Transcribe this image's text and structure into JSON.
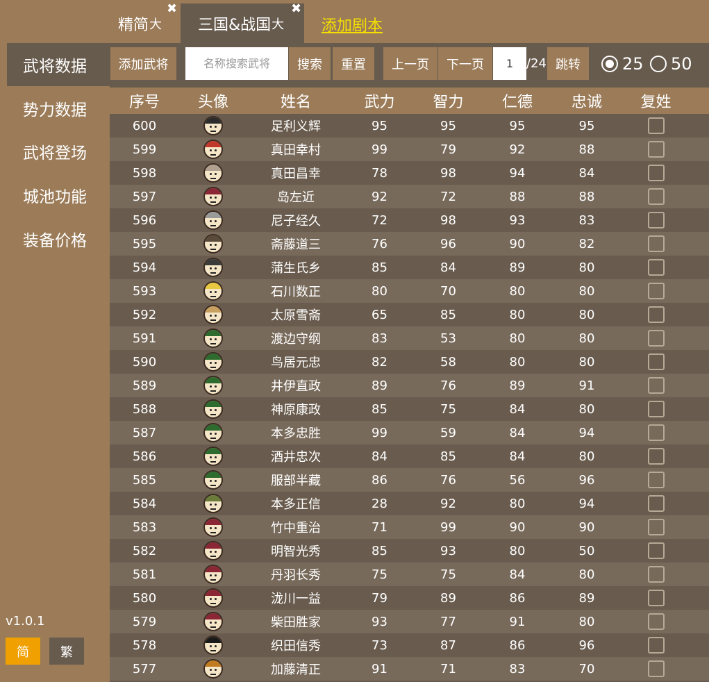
{
  "tabs": [
    {
      "label": "精简",
      "suffix": "大"
    },
    {
      "label": "三国&战国",
      "suffix": "大"
    }
  ],
  "tab_close_glyph": "✖",
  "add_script_label": "添加剧本",
  "toolbar": {
    "add_general": "添加武将",
    "search_placeholder": "名称搜索武将",
    "search": "搜索",
    "reset": "重置",
    "prev_page": "上一页",
    "next_page": "下一页",
    "page_value": "1",
    "page_total": "/24",
    "jump": "跳转",
    "page_size_options": [
      "25",
      "50"
    ],
    "page_size_selected": "25"
  },
  "sidebar": {
    "items": [
      {
        "label": "武将数据",
        "active": true
      },
      {
        "label": "势力数据",
        "active": false
      },
      {
        "label": "武将登场",
        "active": false
      },
      {
        "label": "城池功能",
        "active": false
      },
      {
        "label": "装备价格",
        "active": false
      }
    ],
    "version": "v1.0.1",
    "lang_simplified": "简",
    "lang_traditional": "繁"
  },
  "table": {
    "headers": [
      "序号",
      "头像",
      "姓名",
      "武力",
      "智力",
      "仁德",
      "忠诚",
      "复姓"
    ],
    "rows": [
      {
        "id": "600",
        "name": "足利义辉",
        "war": "95",
        "int": "95",
        "virtue": "95",
        "loyalty": "95",
        "avatar_color": "#2b2b2b"
      },
      {
        "id": "599",
        "name": "真田幸村",
        "war": "99",
        "int": "79",
        "virtue": "92",
        "loyalty": "88",
        "avatar_color": "#c0392b"
      },
      {
        "id": "598",
        "name": "真田昌幸",
        "war": "78",
        "int": "98",
        "virtue": "94",
        "loyalty": "84",
        "avatar_color": "#b0a090"
      },
      {
        "id": "597",
        "name": "岛左近",
        "war": "92",
        "int": "72",
        "virtue": "88",
        "loyalty": "88",
        "avatar_color": "#8b2635"
      },
      {
        "id": "596",
        "name": "尼子经久",
        "war": "72",
        "int": "98",
        "virtue": "93",
        "loyalty": "83",
        "avatar_color": "#9a9a9a"
      },
      {
        "id": "595",
        "name": "斋藤道三",
        "war": "76",
        "int": "96",
        "virtue": "90",
        "loyalty": "82",
        "avatar_color": "#5a4a3a"
      },
      {
        "id": "594",
        "name": "蒲生氏乡",
        "war": "85",
        "int": "84",
        "virtue": "89",
        "loyalty": "80",
        "avatar_color": "#3a3a3a"
      },
      {
        "id": "593",
        "name": "石川数正",
        "war": "80",
        "int": "70",
        "virtue": "80",
        "loyalty": "80",
        "avatar_color": "#e8c840"
      },
      {
        "id": "592",
        "name": "太原雪斋",
        "war": "65",
        "int": "85",
        "virtue": "80",
        "loyalty": "80",
        "avatar_color": "#c8a060"
      },
      {
        "id": "591",
        "name": "渡边守纲",
        "war": "83",
        "int": "53",
        "virtue": "80",
        "loyalty": "80",
        "avatar_color": "#2e6b2e"
      },
      {
        "id": "590",
        "name": "鸟居元忠",
        "war": "82",
        "int": "58",
        "virtue": "80",
        "loyalty": "80",
        "avatar_color": "#2e6b2e"
      },
      {
        "id": "589",
        "name": "井伊直政",
        "war": "89",
        "int": "76",
        "virtue": "89",
        "loyalty": "91",
        "avatar_color": "#2e6b2e"
      },
      {
        "id": "588",
        "name": "神原康政",
        "war": "85",
        "int": "75",
        "virtue": "84",
        "loyalty": "80",
        "avatar_color": "#2e6b2e"
      },
      {
        "id": "587",
        "name": "本多忠胜",
        "war": "99",
        "int": "59",
        "virtue": "84",
        "loyalty": "94",
        "avatar_color": "#2e6b2e"
      },
      {
        "id": "586",
        "name": "酒井忠次",
        "war": "84",
        "int": "85",
        "virtue": "84",
        "loyalty": "80",
        "avatar_color": "#2e6b2e"
      },
      {
        "id": "585",
        "name": "服部半藏",
        "war": "86",
        "int": "76",
        "virtue": "56",
        "loyalty": "96",
        "avatar_color": "#2e6b2e"
      },
      {
        "id": "584",
        "name": "本多正信",
        "war": "28",
        "int": "92",
        "virtue": "80",
        "loyalty": "94",
        "avatar_color": "#6b7b3a"
      },
      {
        "id": "583",
        "name": "竹中重治",
        "war": "71",
        "int": "99",
        "virtue": "90",
        "loyalty": "90",
        "avatar_color": "#8b2635"
      },
      {
        "id": "582",
        "name": "明智光秀",
        "war": "85",
        "int": "93",
        "virtue": "80",
        "loyalty": "50",
        "avatar_color": "#8b2635"
      },
      {
        "id": "581",
        "name": "丹羽长秀",
        "war": "75",
        "int": "75",
        "virtue": "84",
        "loyalty": "80",
        "avatar_color": "#8b2635"
      },
      {
        "id": "580",
        "name": "泷川一益",
        "war": "79",
        "int": "89",
        "virtue": "86",
        "loyalty": "89",
        "avatar_color": "#8b2635"
      },
      {
        "id": "579",
        "name": "柴田胜家",
        "war": "93",
        "int": "77",
        "virtue": "91",
        "loyalty": "80",
        "avatar_color": "#8b2635"
      },
      {
        "id": "578",
        "name": "织田信秀",
        "war": "73",
        "int": "87",
        "virtue": "86",
        "loyalty": "96",
        "avatar_color": "#1a1a1a"
      },
      {
        "id": "577",
        "name": "加藤清正",
        "war": "91",
        "int": "71",
        "virtue": "83",
        "loyalty": "70",
        "avatar_color": "#c07a20"
      }
    ]
  }
}
